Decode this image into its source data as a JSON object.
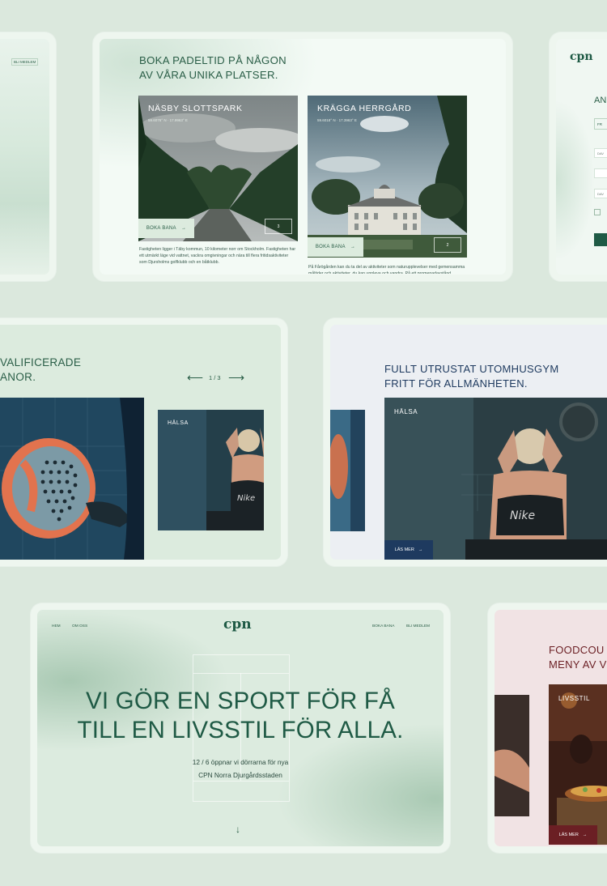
{
  "colors": {
    "bg": "#dbe8dd",
    "brand_green": "#1f5a45",
    "navy": "#1e3a5f",
    "pink_bg": "#f1e3e4",
    "maroon": "#6b1f24"
  },
  "left_card": {
    "nav_member": "BLI MEDLEM"
  },
  "booking": {
    "title_line1": "BOKA PADELTID PÅ NÅGON",
    "title_line2": "AV VÅRA UNIKA PLATSER.",
    "cards": [
      {
        "name": "NÄSBY SLOTTSPARK",
        "coords": "59.6076° N · 17.9963° E",
        "button": "BOKA BANA",
        "count": "3",
        "desc": "Fastigheten ligger i Täby kommun, 10 kilometer norr om Stockholm. Fastigheten har ett utmärkt läge vid vattnet, vackra omgivningar och nära till flera fritidsaktiviteter som Djursholms golfklubb och en båtklubb."
      },
      {
        "name": "KRÄGGA HERRGÅRD",
        "coords": "59.6018° N · 17.3963° E",
        "button": "BOKA BANA",
        "count": "2",
        "desc": "På Fårögården kan du ta del av aktiviteter som naturupplevelser med gemensamma måltider och aktiviteter, du kan uppleva och vandra. På ett promenadavstånd ..."
      }
    ]
  },
  "right_top": {
    "logo": "cpn",
    "heading_partial": "AN",
    "field_label": "FR",
    "field_values": [
      "DAV",
      "DAV"
    ]
  },
  "qualified": {
    "title_line1": "VALIFICERADE",
    "title_line2": "ANOR.",
    "pager": "1 / 3",
    "thumb_label": "HÄLSA",
    "prev_icon": "arrow-left-icon",
    "next_icon": "arrow-right-icon"
  },
  "gym": {
    "title_line1": "FULLT UTRUSTAT UTOMHUSGYM",
    "title_line2": "FRITT FÖR ALLMÄNHETEN.",
    "tag": "HÄLSA",
    "button": "LÄS MER"
  },
  "home": {
    "nav_left": [
      "HEM",
      "OM OSS"
    ],
    "logo": "cpn",
    "nav_right": [
      "BOKA BANA",
      "BLI MEDLEM"
    ],
    "headline_line1": "VI GÖR EN SPORT FÖR FÅ",
    "headline_line2": "TILL EN LIVSSTIL FÖR ALLA.",
    "sub_line1": "12 / 6 öppnar vi dörrarna för nya",
    "sub_line2": "CPN Norra Djurgårdsstaden",
    "scroll_icon": "arrow-down-icon"
  },
  "food": {
    "title_line1": "FOODCOU",
    "title_line2": "MENY AV V",
    "tag": "LIVSSTIL",
    "button": "LÄS MER"
  }
}
